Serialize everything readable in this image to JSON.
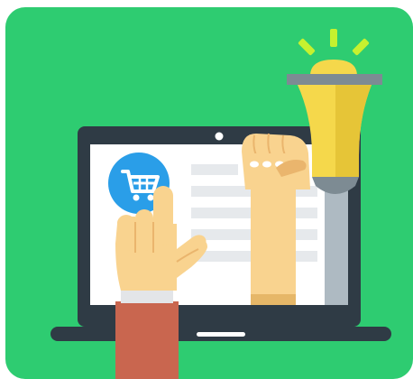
{
  "illustration": {
    "colors": {
      "background": "#2ecc71",
      "laptop_frame": "#2f3b45",
      "screen": "#ffffff",
      "screen_shadow": "#dfe3e6",
      "content_lines": "#e6e9ec",
      "cart_badge": "#2a9ee8",
      "skin": "#f9d38f",
      "skin_shade": "#eab56d",
      "sleeve": "#c9664f",
      "cuff": "#e3e5e8",
      "bulb": "#f5d84b",
      "bulb_shade": "#e6c537",
      "bulb_base": "#7d8b93",
      "bulb_rays": "#c6f12f"
    },
    "icons": [
      "shopping-cart-icon",
      "lightbulb-icon",
      "pointing-hand-icon",
      "raised-fist-icon",
      "laptop-icon"
    ]
  }
}
